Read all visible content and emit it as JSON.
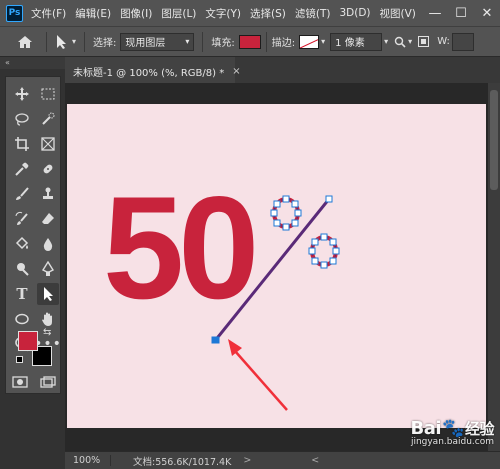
{
  "app": {
    "logo": "Ps",
    "menu": [
      "文件(F)",
      "编辑(E)",
      "图像(I)",
      "图层(L)",
      "文字(Y)",
      "选择(S)",
      "滤镜(T)",
      "3D(D)",
      "视图(V)"
    ],
    "window_controls": {
      "minimize": "—",
      "maximize": "☐",
      "close": "✕"
    }
  },
  "options_bar": {
    "select_label": "选择:",
    "select_value": "现用图层",
    "fill_label": "填充:",
    "stroke_label": "描边:",
    "stroke_width": "1 像素",
    "width_label": "W:",
    "fill_color": "#c8233c"
  },
  "panel": {
    "collapse": "«"
  },
  "document": {
    "tab_title": "未标题-1 @ 100% (%, RGB/8) *",
    "tab_close": "×",
    "canvas_text": "50",
    "canvas_bg": "#f7e1e6",
    "text_color": "#c8233c"
  },
  "status": {
    "zoom": "100%",
    "doc_info": "文档:556.6K/1017.4K",
    "arrow": ">",
    "arrow_left": "<"
  },
  "watermark": {
    "logo_left": "Bai",
    "logo_paw": "🐾",
    "logo_right": "经验",
    "url": "jingyan.baidu.com"
  }
}
